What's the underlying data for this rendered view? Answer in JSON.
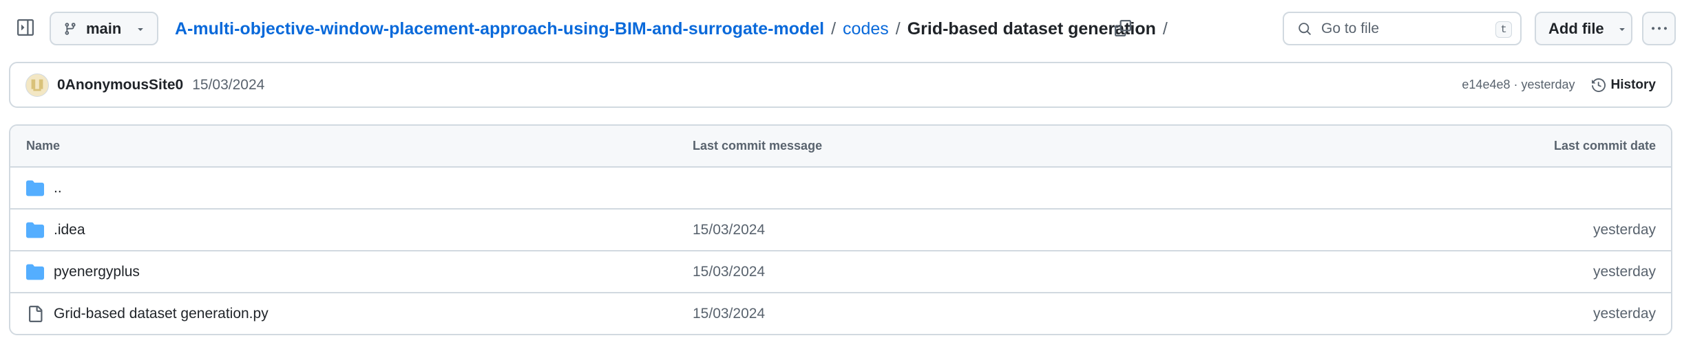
{
  "header": {
    "branch": {
      "label": "main",
      "icon": "git-branch-icon"
    },
    "breadcrumb": {
      "repo": "A-multi-objective-window-placement-approach-using-BIM-and-surrogate-model",
      "separator": "/",
      "folder": "codes",
      "current": "Grid-based dataset generation",
      "trailing_separator": "/"
    },
    "search": {
      "placeholder": "Go to file",
      "value": "",
      "shortcut": "t"
    },
    "add_file_label": "Add file",
    "more_icon": "kebab-horizontal-icon"
  },
  "commit": {
    "author": "0AnonymousSite0",
    "message": "15/03/2024",
    "hash": "e14e4e8",
    "time_separator": " · ",
    "time": "yesterday",
    "history_label": "History"
  },
  "table": {
    "headers": {
      "name": "Name",
      "message": "Last commit message",
      "date": "Last commit date"
    },
    "rows": [
      {
        "name": "..",
        "type": "folder",
        "message": "",
        "date": ""
      },
      {
        "name": ".idea",
        "type": "folder",
        "message": "15/03/2024",
        "date": "yesterday"
      },
      {
        "name": "pyenergyplus",
        "type": "folder",
        "message": "15/03/2024",
        "date": "yesterday"
      },
      {
        "name": "Grid-based dataset generation.py",
        "type": "file",
        "message": "15/03/2024",
        "date": "yesterday"
      }
    ]
  },
  "colors": {
    "link": "#0969da",
    "text": "#1f2328",
    "muted": "#59636e",
    "border": "#d1d9e0",
    "folder": "#54aeff"
  }
}
